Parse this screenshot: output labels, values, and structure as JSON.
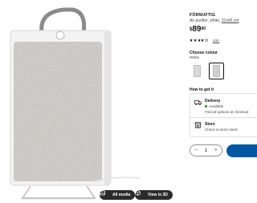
{
  "product": {
    "name": "FÖRNUFTIG",
    "desc_prefix": "Air purifier, white, ",
    "size_link": "31x45 cm",
    "price": {
      "currency": "$",
      "integer": "89",
      "decimals": "90"
    },
    "rating": {
      "stars": 4,
      "max": 5,
      "count": "(26)"
    }
  },
  "color": {
    "label": "Choose colour",
    "value": "White"
  },
  "delivery": {
    "heading": "How to get it",
    "delivery_title": "Delivery",
    "delivery_status": "Available",
    "delivery_sub": "Find all options at checkout",
    "store_title": "Store",
    "store_sub": "Check in-store stock"
  },
  "cart": {
    "quantity": "1",
    "minus": "−",
    "plus": "+"
  },
  "media": {
    "all_media": "All media",
    "view_3d": "View in 3D"
  },
  "colors": {
    "primary": "#0058a3",
    "available": "#0a8a00"
  }
}
